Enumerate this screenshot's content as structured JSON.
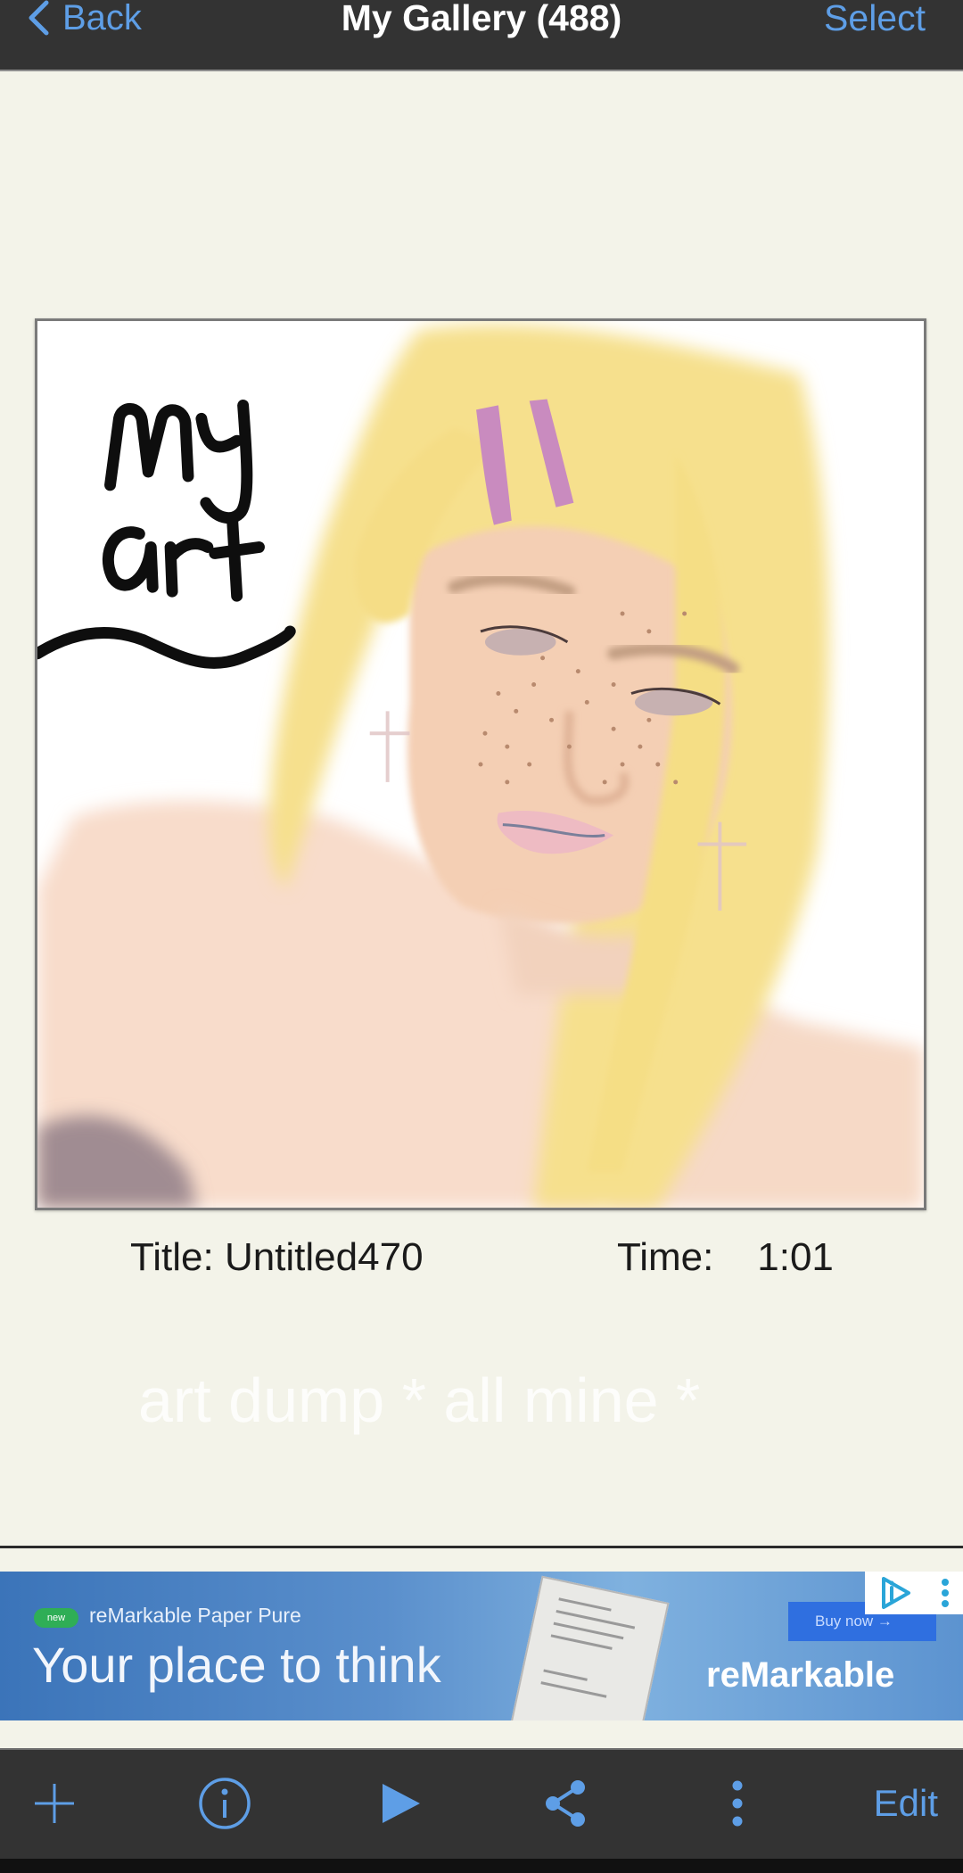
{
  "header": {
    "back_label": "Back",
    "title": "My Gallery (488)",
    "select_label": "Select"
  },
  "artwork": {
    "sketch_text_line1": "my",
    "sketch_text_line2": "art"
  },
  "meta": {
    "title_label": "Title: Untitled470",
    "time_label": "Time:    1:01"
  },
  "caption": "art dump * all mine *",
  "ad": {
    "badge": "new",
    "brand_line": "reMarkable Paper Pure",
    "headline": "Your place to think",
    "cta": "Buy now →",
    "logo": "reMarkable"
  },
  "toolbar": {
    "add_icon": "plus-icon",
    "info_icon": "info-icon",
    "play_icon": "play-icon",
    "share_icon": "share-icon",
    "more_icon": "more-vertical-icon",
    "edit_label": "Edit"
  },
  "colors": {
    "accent": "#5e9ee6",
    "bar_background": "#333333",
    "page_background": "#f3f3e9"
  }
}
